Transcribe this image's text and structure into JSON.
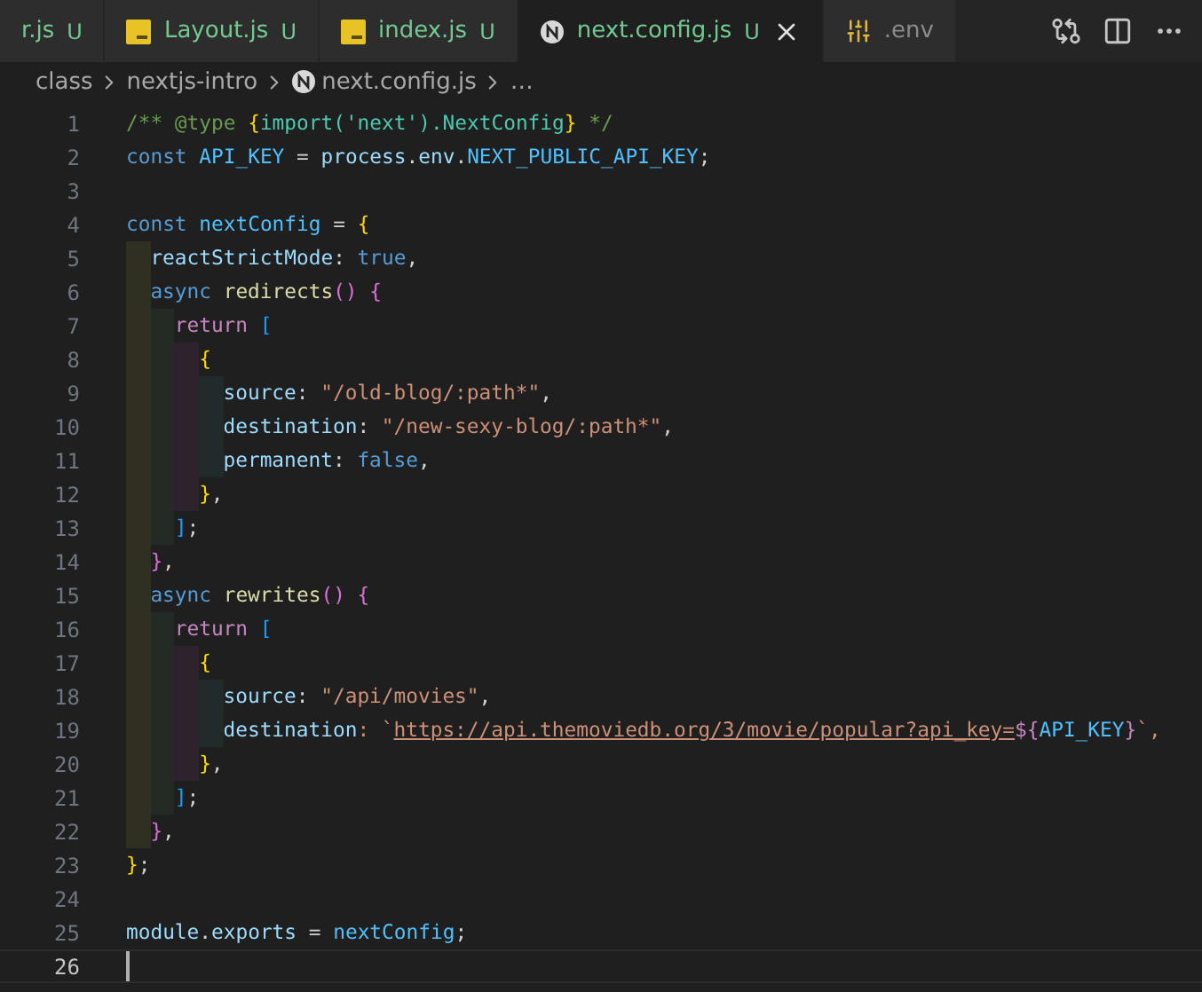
{
  "tabs": [
    {
      "label": "r.js",
      "badge": "U",
      "kind": "plain",
      "selected": false,
      "untracked": true
    },
    {
      "label": "Layout.js",
      "badge": "U",
      "kind": "js",
      "selected": false,
      "untracked": true
    },
    {
      "label": "index.js",
      "badge": "U",
      "kind": "js",
      "selected": false,
      "untracked": true
    },
    {
      "label": "next.config.js",
      "badge": "U",
      "kind": "next",
      "selected": true,
      "untracked": true
    },
    {
      "label": ".env",
      "kind": "env",
      "selected": false,
      "untracked": false
    }
  ],
  "breadcrumb": [
    {
      "label": "class",
      "kind": "folder"
    },
    {
      "label": "nextjs-intro",
      "kind": "folder"
    },
    {
      "label": "next.config.js",
      "kind": "next"
    },
    {
      "label": "…",
      "kind": "symbol"
    }
  ],
  "lines": [
    {
      "number": "1",
      "current": false,
      "tokens": [
        {
          "t": "/** @type ",
          "kind": "comment"
        },
        {
          "t": "{",
          "kind": "b1"
        },
        {
          "t": "import('next').NextConfig",
          "kind": "type"
        },
        {
          "t": "}",
          "kind": "b1"
        },
        {
          "t": " */",
          "kind": "comment"
        }
      ]
    },
    {
      "number": "2",
      "current": false,
      "tokens": [
        {
          "t": "const ",
          "kind": "kw"
        },
        {
          "t": "API_KEY",
          "kind": "const"
        },
        {
          "t": " = ",
          "kind": "p"
        },
        {
          "t": "process",
          "kind": "var"
        },
        {
          "t": ".",
          "kind": "p"
        },
        {
          "t": "env",
          "kind": "var"
        },
        {
          "t": ".",
          "kind": "p"
        },
        {
          "t": "NEXT_PUBLIC_API_KEY",
          "kind": "const"
        },
        {
          "t": ";",
          "kind": "p"
        }
      ]
    },
    {
      "number": "3",
      "current": false
    },
    {
      "number": "4",
      "current": false,
      "tokens": [
        {
          "t": "const ",
          "kind": "kw"
        },
        {
          "t": "nextConfig",
          "kind": "const"
        },
        {
          "t": " = ",
          "kind": "p"
        },
        {
          "t": "{",
          "kind": "b1"
        }
      ],
      "children": [
        {
          "number": "5",
          "current": false,
          "tokens": [
            {
              "t": "reactStrictMode",
              "kind": "var"
            },
            {
              "t": ": ",
              "kind": "p"
            },
            {
              "t": "true",
              "kind": "kw"
            },
            {
              "t": ",",
              "kind": "p"
            }
          ]
        },
        {
          "number": "6",
          "current": false,
          "tokens": [
            {
              "t": "async ",
              "kind": "kw"
            },
            {
              "t": "redirects",
              "kind": "fn"
            },
            {
              "t": "()",
              "kind": "b2"
            },
            {
              "t": " {",
              "kind": "b2"
            }
          ],
          "children": [
            {
              "number": "7",
              "current": false,
              "tokens": [
                {
                  "t": "return ",
                  "kind": "ctrl"
                },
                {
                  "t": "[",
                  "kind": "b3"
                }
              ],
              "children": [
                {
                  "number": "8",
                  "current": false,
                  "tokens": [
                    {
                      "t": "{",
                      "kind": "b1"
                    }
                  ],
                  "children": [
                    {
                      "number": "9",
                      "current": false,
                      "tokens": [
                        {
                          "t": "source",
                          "kind": "var"
                        },
                        {
                          "t": ": ",
                          "kind": "p"
                        },
                        {
                          "t": "\"/old-blog/:path*\"",
                          "kind": "str"
                        },
                        {
                          "t": ",",
                          "kind": "p"
                        }
                      ]
                    },
                    {
                      "number": "10",
                      "current": false,
                      "tokens": [
                        {
                          "t": "destination",
                          "kind": "var"
                        },
                        {
                          "t": ": ",
                          "kind": "p"
                        },
                        {
                          "t": "\"/new-sexy-blog/:path*\"",
                          "kind": "str"
                        },
                        {
                          "t": ",",
                          "kind": "p"
                        }
                      ]
                    },
                    {
                      "number": "11",
                      "current": false,
                      "tokens": [
                        {
                          "t": "permanent",
                          "kind": "var"
                        },
                        {
                          "t": ": ",
                          "kind": "p"
                        },
                        {
                          "t": "false",
                          "kind": "kw"
                        },
                        {
                          "t": ",",
                          "kind": "p"
                        }
                      ]
                    }
                  ]
                },
                {
                  "number": "12",
                  "current": false,
                  "tokens": [
                    {
                      "t": "}",
                      "kind": "b1"
                    },
                    {
                      "t": ",",
                      "kind": "p"
                    }
                  ]
                }
              ]
            },
            {
              "number": "13",
              "current": false,
              "tokens": [
                {
                  "t": "]",
                  "kind": "b3"
                },
                {
                  "t": ";",
                  "kind": "p"
                }
              ]
            }
          ]
        },
        {
          "number": "14",
          "current": false,
          "tokens": [
            {
              "t": "}",
              "kind": "b2"
            },
            {
              "t": ",",
              "kind": "p"
            }
          ]
        },
        {
          "number": "15",
          "current": false,
          "tokens": [
            {
              "t": "async ",
              "kind": "kw"
            },
            {
              "t": "rewrites",
              "kind": "fn"
            },
            {
              "t": "()",
              "kind": "b2"
            },
            {
              "t": " {",
              "kind": "b2"
            }
          ],
          "children": [
            {
              "number": "16",
              "current": false,
              "tokens": [
                {
                  "t": "return ",
                  "kind": "ctrl"
                },
                {
                  "t": "[",
                  "kind": "b3"
                }
              ],
              "children": [
                {
                  "number": "17",
                  "current": false,
                  "tokens": [
                    {
                      "t": "{",
                      "kind": "b1"
                    }
                  ],
                  "children": [
                    {
                      "number": "18",
                      "current": false,
                      "tokens": [
                        {
                          "t": "source",
                          "kind": "var"
                        },
                        {
                          "t": ": ",
                          "kind": "p"
                        },
                        {
                          "t": "\"/api/movies\"",
                          "kind": "str"
                        },
                        {
                          "t": ",",
                          "kind": "p"
                        }
                      ]
                    },
                    {
                      "number": "19",
                      "current": false,
                      "tokens": [
                        {
                          "t": "destination",
                          "kind": "var"
                        },
                        {
                          "t": ": `",
                          "kind": "str"
                        },
                        {
                          "t": "https://api.themoviedb.org/3/movie/popular?api_key=",
                          "kind": "link"
                        },
                        {
                          "t": "${",
                          "kind": "tpl"
                        },
                        {
                          "t": "API_KEY",
                          "kind": "const"
                        },
                        {
                          "t": "}",
                          "kind": "tpl"
                        },
                        {
                          "t": "`,",
                          "kind": "str"
                        }
                      ]
                    }
                  ]
                },
                {
                  "number": "20",
                  "current": false,
                  "tokens": [
                    {
                      "t": "}",
                      "kind": "b1"
                    },
                    {
                      "t": ",",
                      "kind": "p"
                    }
                  ]
                }
              ]
            },
            {
              "number": "21",
              "current": false,
              "tokens": [
                {
                  "t": "]",
                  "kind": "b3"
                },
                {
                  "t": ";",
                  "kind": "p"
                }
              ]
            }
          ]
        },
        {
          "number": "22",
          "current": false,
          "tokens": [
            {
              "t": "}",
              "kind": "b2"
            },
            {
              "t": ",",
              "kind": "p"
            }
          ]
        }
      ]
    },
    {
      "number": "23",
      "current": false,
      "tokens": [
        {
          "t": "}",
          "kind": "b1"
        },
        {
          "t": ";",
          "kind": "p"
        }
      ]
    },
    {
      "number": "24",
      "current": false
    },
    {
      "number": "25",
      "current": false,
      "tokens": [
        {
          "t": "module",
          "kind": "var"
        },
        {
          "t": ".",
          "kind": "p"
        },
        {
          "t": "exports",
          "kind": "var"
        },
        {
          "t": " = ",
          "kind": "p"
        },
        {
          "t": "nextConfig",
          "kind": "const"
        },
        {
          "t": ";",
          "kind": "p"
        }
      ]
    },
    {
      "number": "26",
      "current": true
    }
  ]
}
